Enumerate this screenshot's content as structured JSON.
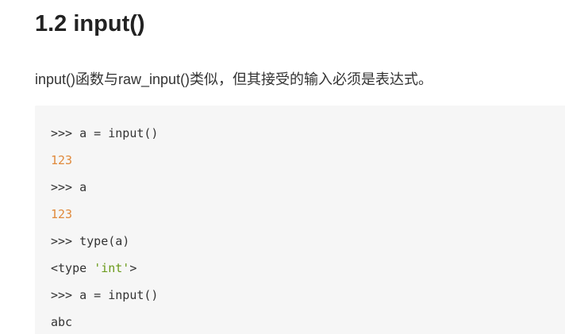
{
  "section": {
    "heading": "1.2 input()",
    "paragraph": "input()函数与raw_input()类似，但其接受的输入必须是表达式。"
  },
  "code": {
    "lines": [
      {
        "text": ">>> a = input()"
      },
      {
        "text": "123",
        "color": "#e08a3c"
      },
      {
        "text": ">>> a"
      },
      {
        "text": "123",
        "color": "#e08a3c"
      },
      {
        "text": ">>> type(a)"
      },
      {
        "prefix": "<type ",
        "string": "'int'",
        "suffix": ">",
        "string_color": "#6a9a1a"
      },
      {
        "text": ">>> a = input()"
      },
      {
        "text": "abc"
      }
    ],
    "background": "#f6f6f6"
  }
}
